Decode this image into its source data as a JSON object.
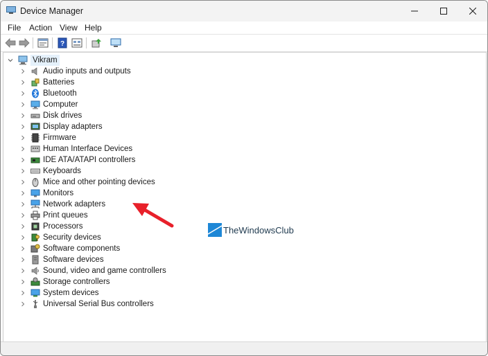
{
  "window": {
    "title": "Device Manager"
  },
  "menu": [
    "File",
    "Action",
    "View",
    "Help"
  ],
  "toolbar_icons": [
    "back-arrow-icon",
    "forward-arrow-icon",
    "properties-icon",
    "help-icon",
    "view-icon",
    "update-driver-icon",
    "scan-hardware-icon"
  ],
  "tree": {
    "root": "Vikram",
    "items": [
      {
        "label": "Audio inputs and outputs",
        "icon": "speaker-icon"
      },
      {
        "label": "Batteries",
        "icon": "battery-icon"
      },
      {
        "label": "Bluetooth",
        "icon": "bluetooth-icon"
      },
      {
        "label": "Computer",
        "icon": "computer-icon"
      },
      {
        "label": "Disk drives",
        "icon": "disk-drive-icon"
      },
      {
        "label": "Display adapters",
        "icon": "display-adapter-icon"
      },
      {
        "label": "Firmware",
        "icon": "firmware-icon"
      },
      {
        "label": "Human Interface Devices",
        "icon": "hid-icon"
      },
      {
        "label": "IDE ATA/ATAPI controllers",
        "icon": "ide-controller-icon"
      },
      {
        "label": "Keyboards",
        "icon": "keyboard-icon"
      },
      {
        "label": "Mice and other pointing devices",
        "icon": "mouse-icon"
      },
      {
        "label": "Monitors",
        "icon": "monitor-icon"
      },
      {
        "label": "Network adapters",
        "icon": "network-adapter-icon"
      },
      {
        "label": "Print queues",
        "icon": "printer-icon"
      },
      {
        "label": "Processors",
        "icon": "processor-icon"
      },
      {
        "label": "Security devices",
        "icon": "security-device-icon"
      },
      {
        "label": "Software components",
        "icon": "software-component-icon"
      },
      {
        "label": "Software devices",
        "icon": "software-device-icon"
      },
      {
        "label": "Sound, video and game controllers",
        "icon": "sound-controller-icon"
      },
      {
        "label": "Storage controllers",
        "icon": "storage-controller-icon"
      },
      {
        "label": "System devices",
        "icon": "system-device-icon"
      },
      {
        "label": "Universal Serial Bus controllers",
        "icon": "usb-icon"
      }
    ]
  },
  "watermark": {
    "text": "TheWindowsClub"
  },
  "colors": {
    "accent": "#0078d4",
    "arrow": "#e8202a",
    "selection": "#e5f1fb"
  }
}
